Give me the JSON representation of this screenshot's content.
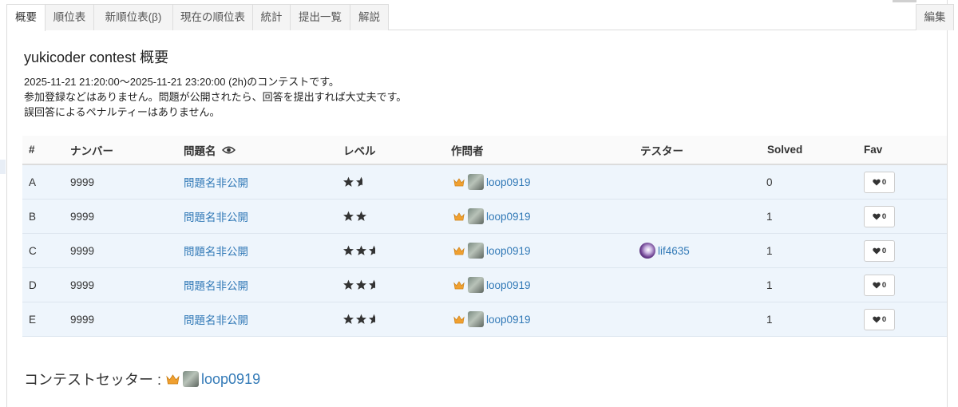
{
  "tabs": [
    {
      "label": "概要",
      "active": true
    },
    {
      "label": "順位表"
    },
    {
      "label": "新順位表(β)"
    },
    {
      "label": "現在の順位表"
    },
    {
      "label": "統計"
    },
    {
      "label": "提出一覧"
    },
    {
      "label": "解説"
    }
  ],
  "edit_tab": {
    "label": "編集"
  },
  "page": {
    "title": "yukicoder contest 概要",
    "notice": [
      "2025-11-21 21:20:00〜2025-11-21 23:20:00 (2h)のコンテストです。",
      "参加登録などはありません。問題が公開されたら、回答を提出すれば大丈夫です。",
      "誤回答によるペナルティーはありません。"
    ]
  },
  "table": {
    "headers": {
      "index": "#",
      "number": "ナンバー",
      "name": "問題名",
      "level": "レベル",
      "author": "作問者",
      "tester": "テスター",
      "solved": "Solved",
      "fav": "Fav"
    },
    "rows": [
      {
        "index": "A",
        "number": "9999",
        "name": "問題名非公開",
        "level_stars": 1.5,
        "author": "loop0919",
        "tester": "",
        "solved": "0",
        "fav": "0"
      },
      {
        "index": "B",
        "number": "9999",
        "name": "問題名非公開",
        "level_stars": 2,
        "author": "loop0919",
        "tester": "",
        "solved": "1",
        "fav": "0"
      },
      {
        "index": "C",
        "number": "9999",
        "name": "問題名非公開",
        "level_stars": 2.5,
        "author": "loop0919",
        "tester": "lif4635",
        "solved": "1",
        "fav": "0"
      },
      {
        "index": "D",
        "number": "9999",
        "name": "問題名非公開",
        "level_stars": 2.5,
        "author": "loop0919",
        "tester": "",
        "solved": "1",
        "fav": "0"
      },
      {
        "index": "E",
        "number": "9999",
        "name": "問題名非公開",
        "level_stars": 2.5,
        "author": "loop0919",
        "tester": "",
        "solved": "1",
        "fav": "0"
      }
    ]
  },
  "setter": {
    "label": "コンテストセッター :",
    "name": "loop0919"
  },
  "icons": {
    "eye": "eye-icon",
    "star": "star-icon",
    "crown": "crown-icon",
    "heart": "heart-icon",
    "avatar": "avatar"
  },
  "colors": {
    "link": "#337ab7",
    "row_bg": "#eef5fc",
    "star": "#333333",
    "crown": "#f0a030",
    "tester_avatar": "#6a3d8f"
  }
}
